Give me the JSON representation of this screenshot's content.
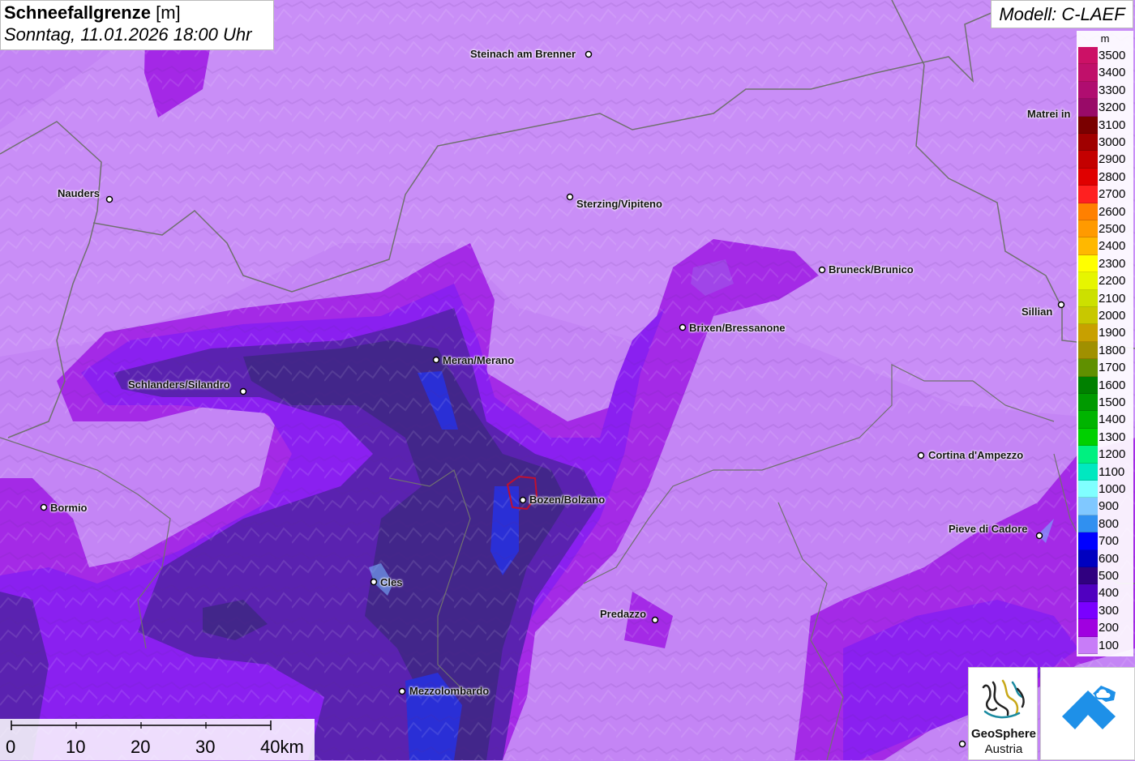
{
  "header": {
    "title_bold": "Schneefallgrenze",
    "title_unit": "[m]",
    "date": "Sonntag, 11.01.2026 18:00 Uhr"
  },
  "model": {
    "label": "Modell: C-LAEF"
  },
  "legend": {
    "unit": "m",
    "items": [
      {
        "label": "3500",
        "color": "#cc1166"
      },
      {
        "label": "3400",
        "color": "#c0106a"
      },
      {
        "label": "3300",
        "color": "#b00d70"
      },
      {
        "label": "3200",
        "color": "#990a68"
      },
      {
        "label": "3100",
        "color": "#7a0000"
      },
      {
        "label": "3000",
        "color": "#a00000"
      },
      {
        "label": "2900",
        "color": "#c40000"
      },
      {
        "label": "2800",
        "color": "#e00000"
      },
      {
        "label": "2700",
        "color": "#ff2020"
      },
      {
        "label": "2600",
        "color": "#ff8000"
      },
      {
        "label": "2500",
        "color": "#ff9a00"
      },
      {
        "label": "2400",
        "color": "#ffb800"
      },
      {
        "label": "2300",
        "color": "#ffff00"
      },
      {
        "label": "2200",
        "color": "#e6f500"
      },
      {
        "label": "2100",
        "color": "#cce000"
      },
      {
        "label": "2000",
        "color": "#c8c800"
      },
      {
        "label": "1900",
        "color": "#c8a000"
      },
      {
        "label": "1800",
        "color": "#a09000"
      },
      {
        "label": "1700",
        "color": "#609000"
      },
      {
        "label": "1600",
        "color": "#008000"
      },
      {
        "label": "1500",
        "color": "#009a00"
      },
      {
        "label": "1400",
        "color": "#00b400"
      },
      {
        "label": "1300",
        "color": "#00d000"
      },
      {
        "label": "1200",
        "color": "#00f080"
      },
      {
        "label": "1100",
        "color": "#00e8c0"
      },
      {
        "label": "1000",
        "color": "#80ffff"
      },
      {
        "label": "900",
        "color": "#80c8ff"
      },
      {
        "label": "800",
        "color": "#3090f0"
      },
      {
        "label": "700",
        "color": "#0000ff"
      },
      {
        "label": "600",
        "color": "#0000c0"
      },
      {
        "label": "500",
        "color": "#300080"
      },
      {
        "label": "400",
        "color": "#5000c0"
      },
      {
        "label": "300",
        "color": "#7a00ff"
      },
      {
        "label": "200",
        "color": "#a000e0"
      },
      {
        "label": "100",
        "color": "#c87cf8"
      }
    ]
  },
  "cities": [
    {
      "name": "Steinach am Brenner"
    },
    {
      "name": "Nauders"
    },
    {
      "name": "Sterzing/Vipiteno"
    },
    {
      "name": "Matrei in"
    },
    {
      "name": "Bruneck/Brunico"
    },
    {
      "name": "Sillian"
    },
    {
      "name": "Brixen/Bressanone"
    },
    {
      "name": "Meran/Merano"
    },
    {
      "name": "Schlanders/Silandro"
    },
    {
      "name": "Cortina d'Ampezzo"
    },
    {
      "name": "Bozen/Bolzano"
    },
    {
      "name": "Bormio"
    },
    {
      "name": "Pieve di Cadore"
    },
    {
      "name": "Cles"
    },
    {
      "name": "Predazzo"
    },
    {
      "name": "Mezzolombardo"
    }
  ],
  "scale": {
    "labels": [
      "0",
      "10",
      "20",
      "30",
      "40km"
    ]
  },
  "logos": {
    "geosphere_line1": "GeoSphere",
    "geosphere_line2": "Austria"
  }
}
